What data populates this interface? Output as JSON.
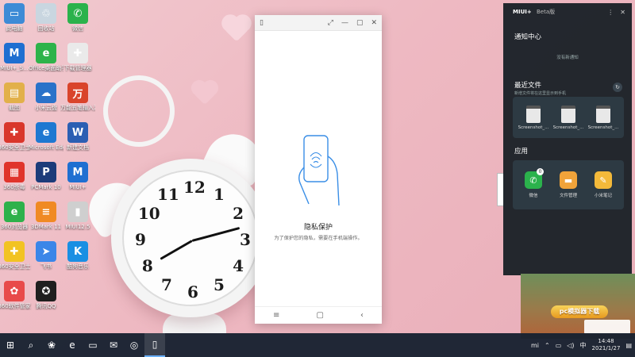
{
  "desktop": {
    "icons": [
      {
        "label": "此电脑",
        "color": "#3d8bd6",
        "glyph": "▭"
      },
      {
        "label": "回收站",
        "color": "#c9d6e0",
        "glyph": "♲"
      },
      {
        "label": "微信",
        "color": "#2bb24c",
        "glyph": "✆"
      },
      {
        "label": "MIUI+_S...",
        "color": "#1f6fd1",
        "glyph": "M"
      },
      {
        "label": "Office桌面助手",
        "color": "#2db34a",
        "glyph": "e"
      },
      {
        "label": "下载管理器",
        "color": "#eaeaea",
        "glyph": "✚"
      },
      {
        "label": "截图",
        "color": "#e2b04a",
        "glyph": "▤"
      },
      {
        "label": "小米云盘",
        "color": "#2a72c9",
        "glyph": "☁"
      },
      {
        "label": "万能五笔输入法",
        "color": "#d9442b",
        "glyph": "万"
      },
      {
        "label": "360安全卫士",
        "color": "#d9362b",
        "glyph": "✚"
      },
      {
        "label": "Microsoft Edge",
        "color": "#1f78d1",
        "glyph": "e"
      },
      {
        "label": "新建文档",
        "color": "#2b5fb3",
        "glyph": "W"
      },
      {
        "label": "360杀毒",
        "color": "#e0342b",
        "glyph": "▦"
      },
      {
        "label": "PCMark 10",
        "color": "#1c3c7a",
        "glyph": "P"
      },
      {
        "label": "MIUI+",
        "color": "#1f6fd1",
        "glyph": "M"
      },
      {
        "label": "360浏览器",
        "color": "#2eb14b",
        "glyph": "e"
      },
      {
        "label": "3DMark 11",
        "color": "#f08a24",
        "glyph": "≡"
      },
      {
        "label": "MIUI12.5",
        "color": "#cfcfcf",
        "glyph": "▮"
      },
      {
        "label": "360安全卫士",
        "color": "#f2c322",
        "glyph": "✚"
      },
      {
        "label": "飞书",
        "color": "#3b86e8",
        "glyph": "➤"
      },
      {
        "label": "酷狗音乐",
        "color": "#1a8fe3",
        "glyph": "K"
      },
      {
        "label": "360软件管家",
        "color": "#e84a4a",
        "glyph": "✿"
      },
      {
        "label": "腾讯QQ",
        "color": "#1f1f1f",
        "glyph": "✪"
      }
    ]
  },
  "phone_window": {
    "title_icon": "phone-outline-icon",
    "privacy_title": "隐私保护",
    "privacy_desc": "为了保护您的隐私，需要在手机端操作。",
    "nav": {
      "menu": "≡",
      "home": "▢",
      "back": "‹"
    }
  },
  "notification_panel": {
    "brand": "MIUI+",
    "beta": "Beta版",
    "notification_center_title": "通知中心",
    "no_notifications": "没有新通知",
    "recent_files_title": "最近文件",
    "recent_files_subtitle": "新增文件将在这里显示到手机",
    "recent_files": [
      {
        "name": "Screenshot_..."
      },
      {
        "name": "Screenshot_..."
      },
      {
        "name": "Screenshot_..."
      }
    ],
    "apps_title": "应用",
    "apps": [
      {
        "name": "微信",
        "color": "#2bb24c",
        "glyph": "✆",
        "badge": "0"
      },
      {
        "name": "文件管理",
        "color": "#f0a33a",
        "glyph": "▬"
      },
      {
        "name": "小米笔记",
        "color": "#f3b93a",
        "glyph": "✎"
      }
    ]
  },
  "ad": {
    "button_label": "pc模拟器下载"
  },
  "taskbar": {
    "items": [
      {
        "name": "start-button",
        "glyph": "⊞"
      },
      {
        "name": "search-button",
        "glyph": "⌕"
      },
      {
        "name": "task-view-button",
        "glyph": "❀"
      },
      {
        "name": "edge-taskbar",
        "glyph": "e"
      },
      {
        "name": "explorer-taskbar",
        "glyph": "▭"
      },
      {
        "name": "mail-taskbar",
        "glyph": "✉"
      },
      {
        "name": "360-taskbar",
        "glyph": "◎"
      },
      {
        "name": "miui-taskbar",
        "glyph": "▯"
      }
    ],
    "tray": {
      "mi": "mi",
      "time": "14:48",
      "date": "2021/1/27",
      "lang": "中"
    }
  }
}
